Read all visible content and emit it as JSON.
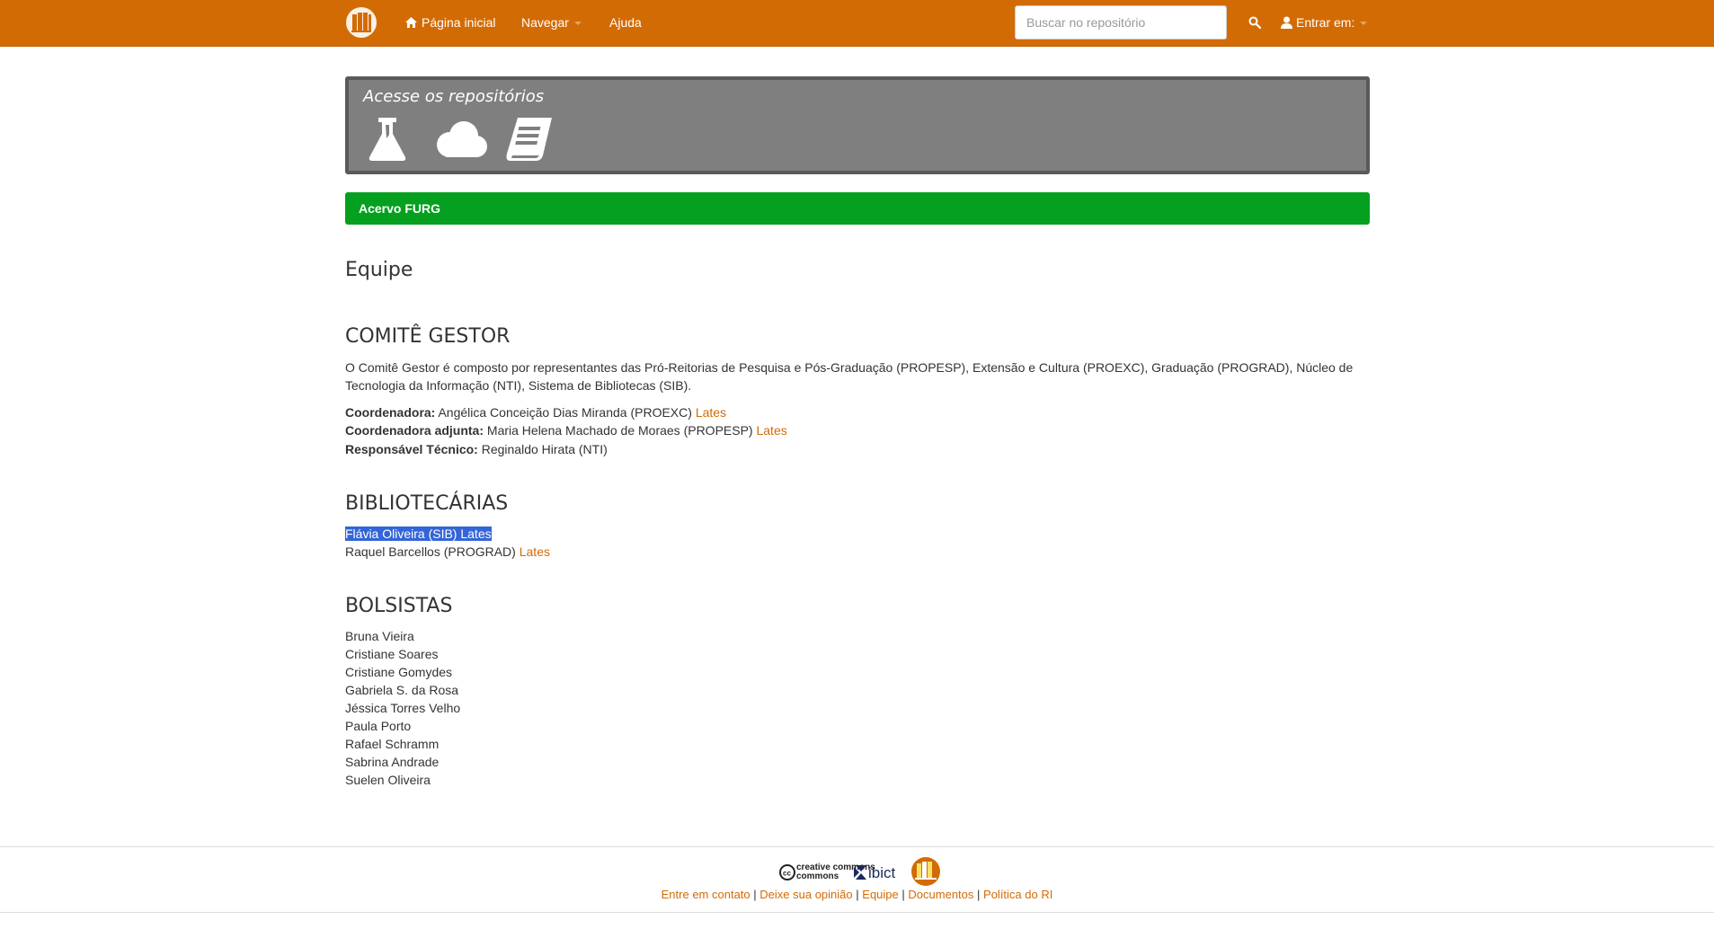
{
  "nav": {
    "home_label": "Página inicial",
    "browse_label": "Navegar",
    "help_label": "Ajuda",
    "search_placeholder": "Buscar no repositório",
    "login_label": "Entrar em:"
  },
  "repos": {
    "title": "Acesse os repositórios",
    "icons": [
      "flask-icon",
      "cloud-icon",
      "book-icon"
    ]
  },
  "breadcrumb": {
    "label": "Acervo FURG"
  },
  "page_title": "Equipe",
  "comite": {
    "heading": "COMITÊ GESTOR",
    "description": "O Comitê Gestor é composto por representantes das Pró-Reitorias de Pesquisa e Pós-Graduação (PROPESP), Extensão e Cultura (PROEXC), Graduação (PROGRAD), Núcleo de Tecnologia da Informação (NTI), Sistema de Bibliotecas (SIB).",
    "members": [
      {
        "role": "Coordenadora:",
        "name": "Angélica Conceição Dias Miranda (PROEXC)",
        "link": "Lates"
      },
      {
        "role": "Coordenadora adjunta:",
        "name": "Maria Helena Machado de Moraes (PROPESP)",
        "link": "Lates"
      },
      {
        "role": "Responsável Técnico:",
        "name": "Reginaldo Hirata (NTI)"
      }
    ]
  },
  "bibliotecarias": {
    "heading": "BIBLIOTECÁRIAS",
    "members": [
      {
        "name": "Flávia Oliveira (SIB)",
        "link": "Lates"
      },
      {
        "name": "Raquel Barcellos (PROGRAD)",
        "link": "Lates"
      }
    ]
  },
  "bolsistas": {
    "heading": "BOLSISTAS",
    "names": [
      "Bruna Vieira",
      "Cristiane Soares",
      "Cristiane Gomydes",
      "Gabriela S. da Rosa",
      "Jéssica Torres Velho",
      "Paula Porto",
      "Rafael Schramm",
      "Sabrina Andrade",
      "Suelen Oliveira"
    ]
  },
  "footer": {
    "logos": {
      "cc": "creative commons",
      "ibict": "ibict"
    },
    "links": [
      "Entre em contato",
      "Deixe sua opinião",
      "Equipe",
      "Documentos",
      "Política do RI"
    ],
    "separator": "|"
  },
  "colors": {
    "navbar": "#d36b05",
    "breadcrumb": "#05a020",
    "link": "#d36b05",
    "repo_box": "#7f7f7f"
  }
}
